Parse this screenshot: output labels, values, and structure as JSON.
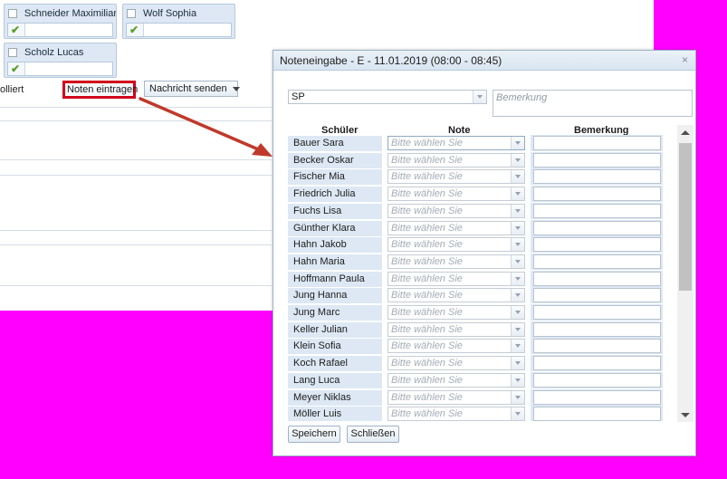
{
  "background": {
    "students": [
      {
        "name": "Schneider Maximiliar"
      },
      {
        "name": "Wolf Sophia"
      },
      {
        "name": "Scholz Lucas"
      }
    ],
    "status_text": "olliert",
    "noten_button": "Noten eintragen",
    "nachricht_button": "Nachricht senden"
  },
  "modal": {
    "title": "Noteneingabe - E - 11.01.2019 (08:00 - 08:45)",
    "close_icon": "×",
    "subject": "SP",
    "bemerkung_placeholder": "Bemerkung",
    "columns": {
      "student": "Schüler",
      "note": "Note",
      "remark": "Bemerkung"
    },
    "note_placeholder": "Bitte wählen Sie",
    "rows": [
      {
        "name": "Bauer Sara"
      },
      {
        "name": "Becker Oskar"
      },
      {
        "name": "Fischer Mia"
      },
      {
        "name": "Friedrich Julia"
      },
      {
        "name": "Fuchs Lisa"
      },
      {
        "name": "Günther Klara"
      },
      {
        "name": "Hahn Jakob"
      },
      {
        "name": "Hahn Maria"
      },
      {
        "name": "Hoffmann Paula"
      },
      {
        "name": "Jung Hanna"
      },
      {
        "name": "Jung Marc"
      },
      {
        "name": "Keller Julian"
      },
      {
        "name": "Klein Sofia"
      },
      {
        "name": "Koch Rafael"
      },
      {
        "name": "Lang Luca"
      },
      {
        "name": "Meyer Niklas"
      },
      {
        "name": "Möller Luis"
      }
    ],
    "save_button": "Speichern",
    "close_button": "Schließen"
  },
  "colors": {
    "highlight_border": "#d0021b",
    "arrow": "#c0392b",
    "overlay": "#ff00ff"
  }
}
